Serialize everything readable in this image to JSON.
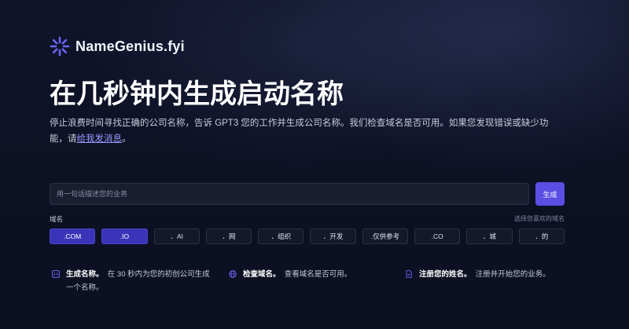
{
  "brand": {
    "name": "NameGenius.fyi",
    "icon": "sparkle-burst-icon",
    "accent": "#5a4ee3"
  },
  "hero": {
    "headline": "在几秒钟内生成启动名称",
    "description_before_link": "停止浪费时间寻找正确的公司名称，告诉 GPT3 您的工作并生成公司名称。我们检查域名是否可用。如果您发现错误或缺少功能，请",
    "link_text": "给我发消息",
    "description_after_link": "。"
  },
  "search": {
    "placeholder": "用一句话描述您的业务",
    "value": "",
    "button_label": "生成"
  },
  "domains": {
    "label": "域名",
    "hint": "选择您喜欢的域名",
    "options": [
      {
        "label": ".COM",
        "selected": true
      },
      {
        "label": ".IO",
        "selected": true
      },
      {
        "label": "．AI",
        "selected": false
      },
      {
        "label": "．网",
        "selected": false
      },
      {
        "label": "．组织",
        "selected": false
      },
      {
        "label": "．开发",
        "selected": false
      },
      {
        "label": ".仅供参考",
        "selected": false
      },
      {
        "label": ".CO",
        "selected": false
      },
      {
        "label": "．城",
        "selected": false
      },
      {
        "label": "．的",
        "selected": false
      }
    ]
  },
  "features": [
    {
      "icon": "code-bracket-icon",
      "title": "生成名称。",
      "text": "在 30 秒内为您的初创公司生成一个名称。"
    },
    {
      "icon": "globe-icon",
      "title": "检查域名。",
      "text": "查看域名是否可用。"
    },
    {
      "icon": "document-check-icon",
      "title": "注册您的姓名。",
      "text": "注册并开始您的业务。"
    }
  ]
}
